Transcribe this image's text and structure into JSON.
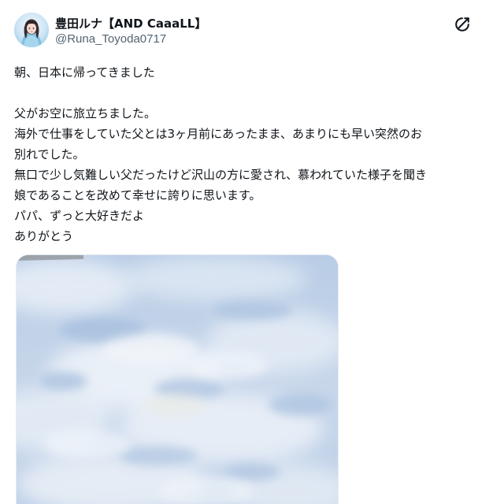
{
  "author": {
    "display_name": "豊田ルナ【AND CaaaLL】",
    "handle": "@Runa_Toyoda0717"
  },
  "icons": {
    "avatar": "profile-photo",
    "header_action": "x-logo-icon"
  },
  "tweet": {
    "lines": [
      "朝、日本に帰ってきました",
      "",
      "父がお空に旅立ちました。",
      "海外で仕事をしていた父とは3ヶ月前にあったまま、あまりにも早い突然のお",
      "別れでした。",
      "無口で少し気難しい父だったけど沢山の方に愛され、慕われていた様子を聞き",
      "娘であることを改めて幸せに誇りに思います。",
      "パパ、ずっと大好きだよ",
      "ありがとう"
    ]
  },
  "media": {
    "type": "photo",
    "subject": "sky",
    "colors": {
      "sky": "#b7cde6",
      "cloud": "#eef3f9"
    }
  },
  "colors": {
    "text": "#0f1419",
    "secondary": "#536471",
    "border": "#e6ecf0",
    "background": "#ffffff"
  }
}
